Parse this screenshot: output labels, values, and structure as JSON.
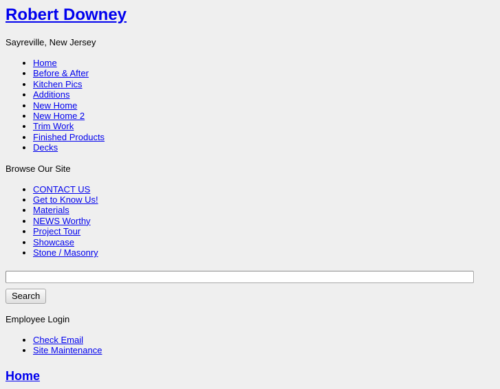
{
  "site": {
    "title": "Robert Downey",
    "tagline": "Sayreville, New Jersey"
  },
  "primary_nav": {
    "items": [
      {
        "label": "Home"
      },
      {
        "label": "Before & After"
      },
      {
        "label": "Kitchen Pics"
      },
      {
        "label": "Additions"
      },
      {
        "label": "New Home"
      },
      {
        "label": "New Home 2"
      },
      {
        "label": "Trim Work"
      },
      {
        "label": "Finished Products"
      },
      {
        "label": "Decks"
      }
    ]
  },
  "browse": {
    "label": "Browse Our Site",
    "items": [
      {
        "label": "CONTACT US"
      },
      {
        "label": "Get to Know Us!"
      },
      {
        "label": "Materials"
      },
      {
        "label": "NEWS Worthy"
      },
      {
        "label": "Project Tour"
      },
      {
        "label": "Showcase"
      },
      {
        "label": "Stone / Masonry"
      }
    ]
  },
  "search": {
    "value": "",
    "placeholder": "",
    "button_label": "Search"
  },
  "employee": {
    "label": "Employee Login",
    "items": [
      {
        "label": "Check Email"
      },
      {
        "label": "Site Maintenance"
      }
    ]
  },
  "content": {
    "heading": "Home"
  },
  "colors": {
    "background": "#efefef",
    "link": "#0000ee",
    "text": "#000000"
  }
}
